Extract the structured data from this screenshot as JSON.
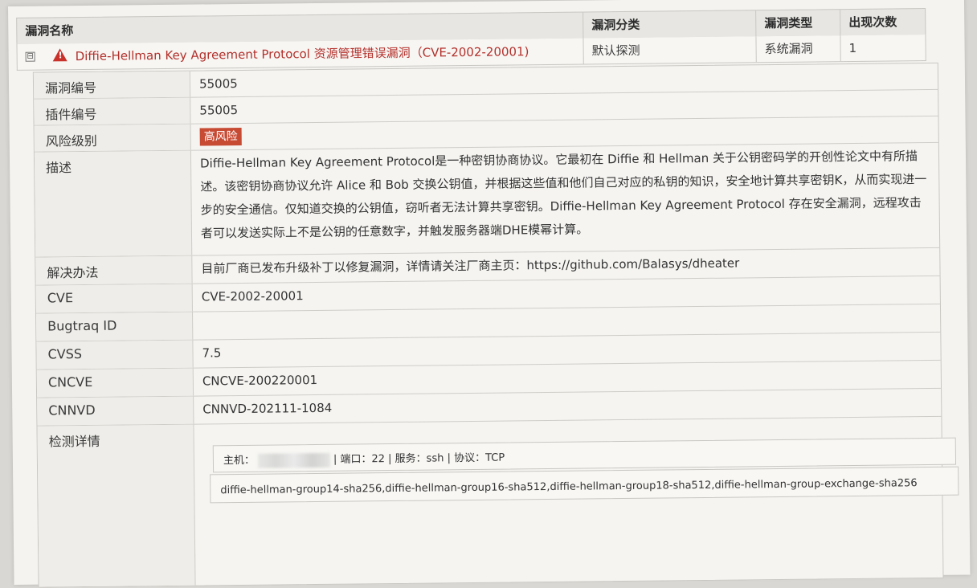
{
  "header": {
    "col_name": "漏洞名称",
    "col_category": "漏洞分类",
    "col_type": "漏洞类型",
    "col_count": "出现次数"
  },
  "vuln_row": {
    "expander": "⊟",
    "warning_icon": "warning-triangle-icon",
    "title": "Diffie-Hellman Key Agreement Protocol 资源管理错误漏洞（CVE-2002-20001)",
    "category": "默认探测",
    "type": "系统漏洞",
    "count": "1"
  },
  "details": {
    "vuln_id_label": "漏洞编号",
    "vuln_id": "55005",
    "plugin_id_label": "插件编号",
    "plugin_id": "55005",
    "risk_label": "风险级别",
    "risk": "高风险",
    "risk_color": "#c74a33",
    "desc_label": "描述",
    "desc": "Diffie-Hellman Key Agreement Protocol是一种密钥协商协议。它最初在 Diffie 和 Hellman 关于公钥密码学的开创性论文中有所描述。该密钥协商协议允许 Alice 和 Bob 交换公钥值，并根据这些值和他们自己对应的私钥的知识，安全地计算共享密钥K，从而实现进一步的安全通信。仅知道交换的公钥值，窃听者无法计算共享密钥。Diffie-Hellman Key Agreement Protocol 存在安全漏洞，远程攻击者可以发送实际上不是公钥的任意数字，并触发服务器端DHE模幂计算。",
    "solution_label": "解决办法",
    "solution": "目前厂商已发布升级补丁以修复漏洞，详情请关注厂商主页：https://github.com/Balasys/dheater",
    "cve_label": "CVE",
    "cve": "CVE-2002-20001",
    "bugtraq_label": "Bugtraq ID",
    "bugtraq": "",
    "cvss_label": "CVSS",
    "cvss": "7.5",
    "cncve_label": "CNCVE",
    "cncve": "CNCVE-200220001",
    "cnnvd_label": "CNNVD",
    "cnnvd": "CNNVD-202111-1084",
    "detect_label": "检测详情",
    "host_prefix": "主机：",
    "host_rest": "| 端口：22 | 服务：ssh | 协议：TCP",
    "algorithms": "diffie-hellman-group14-sha256,diffie-hellman-group16-sha512,diffie-hellman-group18-sha512,diffie-hellman-group-exchange-sha256"
  }
}
